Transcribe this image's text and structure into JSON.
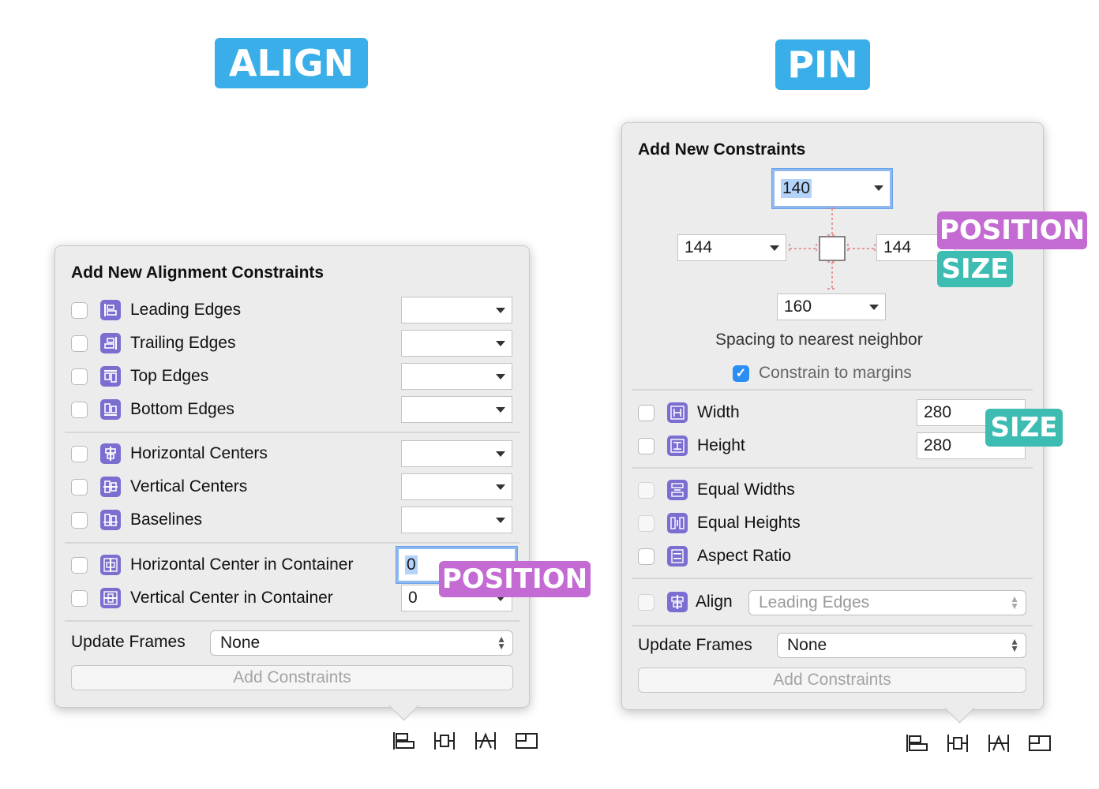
{
  "labels": {
    "align": "ALIGN",
    "pin": "PIN",
    "position": "POSITION",
    "size": "SIZE"
  },
  "align": {
    "title": "Add New Alignment Constraints",
    "rows": [
      {
        "label": "Leading Edges",
        "icon": "leading-edges-icon"
      },
      {
        "label": "Trailing Edges",
        "icon": "trailing-edges-icon"
      },
      {
        "label": "Top Edges",
        "icon": "top-edges-icon"
      },
      {
        "label": "Bottom Edges",
        "icon": "bottom-edges-icon"
      },
      {
        "label": "Horizontal Centers",
        "icon": "horizontal-centers-icon"
      },
      {
        "label": "Vertical Centers",
        "icon": "vertical-centers-icon"
      },
      {
        "label": "Baselines",
        "icon": "baselines-icon"
      },
      {
        "label": "Horizontal Center in Container",
        "icon": "horizontal-center-container-icon",
        "value": "0"
      },
      {
        "label": "Vertical Center in Container",
        "icon": "vertical-center-container-icon",
        "value": "0"
      }
    ],
    "update_frames_label": "Update Frames",
    "update_frames_value": "None",
    "add_button": "Add Constraints"
  },
  "pin": {
    "title": "Add New Constraints",
    "top": "140",
    "left": "144",
    "right": "144",
    "bottom": "160",
    "spacing_label": "Spacing to nearest neighbor",
    "margins_label": "Constrain to margins",
    "width_label": "Width",
    "width_value": "280",
    "height_label": "Height",
    "height_value": "280",
    "equal_widths": "Equal Widths",
    "equal_heights": "Equal Heights",
    "aspect_ratio": "Aspect Ratio",
    "align_label": "Align",
    "align_value": "Leading Edges",
    "update_frames_label": "Update Frames",
    "update_frames_value": "None",
    "add_button": "Add Constraints"
  },
  "colors": {
    "label_blue": "#3aaee8",
    "label_purple": "#c46bd3",
    "label_teal": "#3dbcb2",
    "icon_purple": "#7a6fd0",
    "checkbox_blue": "#2b8ef3"
  },
  "toolbar_icons": [
    "align-icon",
    "pin-icon",
    "resolve-icon",
    "resizing-icon"
  ]
}
